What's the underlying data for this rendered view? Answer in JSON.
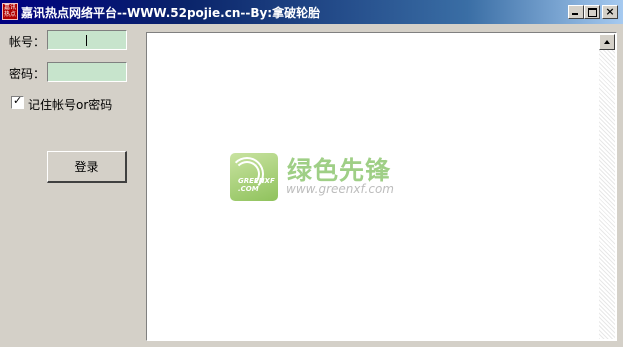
{
  "window": {
    "title": "嘉讯热点网络平台--WWW.52pojie.cn--By:拿破轮胎",
    "icon_text": [
      "嘉讯",
      "热点",
      "网络"
    ]
  },
  "titlebar_buttons": {
    "minimize_icon": "minimize-icon",
    "maximize_icon": "maximize-icon",
    "close_label": "×"
  },
  "form": {
    "account_label": "帐号：",
    "account_value": "",
    "password_label": "密码：",
    "password_value": "",
    "remember_label": "记住帐号or密码",
    "remember_checked": true,
    "login_label": "登录"
  },
  "watermark": {
    "brand": "绿色先锋",
    "logo_text": [
      "GREENXF",
      ".COM"
    ],
    "url": "www.greenxf.com",
    "colors": {
      "brand": "#9fcf86",
      "logo": "#8fc25c",
      "url": "#bdbdbd"
    }
  },
  "colors": {
    "titlebar_start": "#000080",
    "titlebar_end": "#a6caf0",
    "field_bg": "#c7e4cc",
    "window_bg": "#d4d0c8"
  }
}
